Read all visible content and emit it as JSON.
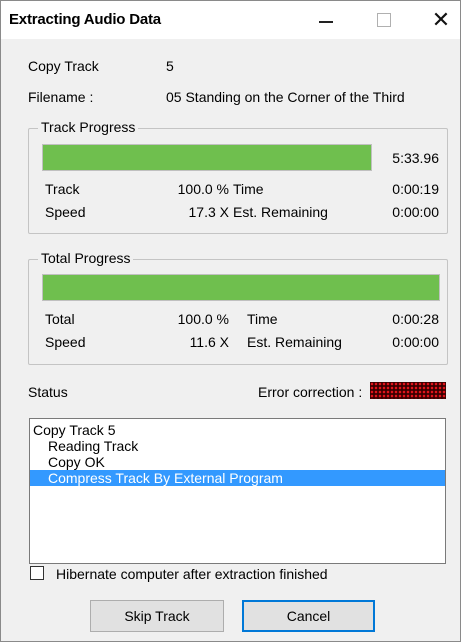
{
  "window": {
    "title": "Extracting Audio Data",
    "controls": {
      "minimize": "minimize-icon",
      "maximize": "maximize-icon",
      "close": "close-icon",
      "close_glyph": "✕"
    }
  },
  "copy_track": {
    "label": "Copy Track",
    "value": "5"
  },
  "filename": {
    "label": "Filename :",
    "value": "05 Standing on the Corner of the Third"
  },
  "track_progress": {
    "title": "Track Progress",
    "progress": 1.0,
    "duration": "5:33.96",
    "track_label": "Track",
    "track_value": "100.0 %",
    "time_label": "Time",
    "time_value": "0:00:19",
    "speed_label": "Speed",
    "speed_value": "17.3 X",
    "remaining_label": "Est. Remaining",
    "remaining_value": "0:00:00"
  },
  "total_progress": {
    "title": "Total Progress",
    "progress": 1.0,
    "total_label": "Total",
    "total_value": "100.0 %",
    "time_label": "Time",
    "time_value": "0:00:28",
    "speed_label": "Speed",
    "speed_value": "11.6 X",
    "remaining_label": "Est. Remaining",
    "remaining_value": "0:00:00"
  },
  "status": {
    "label": "Status",
    "error_correction_label": "Error correction :",
    "items": [
      {
        "text": "Copy Track  5"
      },
      {
        "text": "Reading Track"
      },
      {
        "text": "Copy OK"
      },
      {
        "text": "Compress Track By External Program"
      }
    ],
    "selected_index": 3
  },
  "hibernate": {
    "label": "Hibernate computer after extraction finished",
    "checked": false
  },
  "buttons": {
    "skip": "Skip Track",
    "cancel": "Cancel"
  },
  "colors": {
    "progress": "#6fbf4e",
    "selection": "#3399ff",
    "error_led": "#e0141b"
  }
}
